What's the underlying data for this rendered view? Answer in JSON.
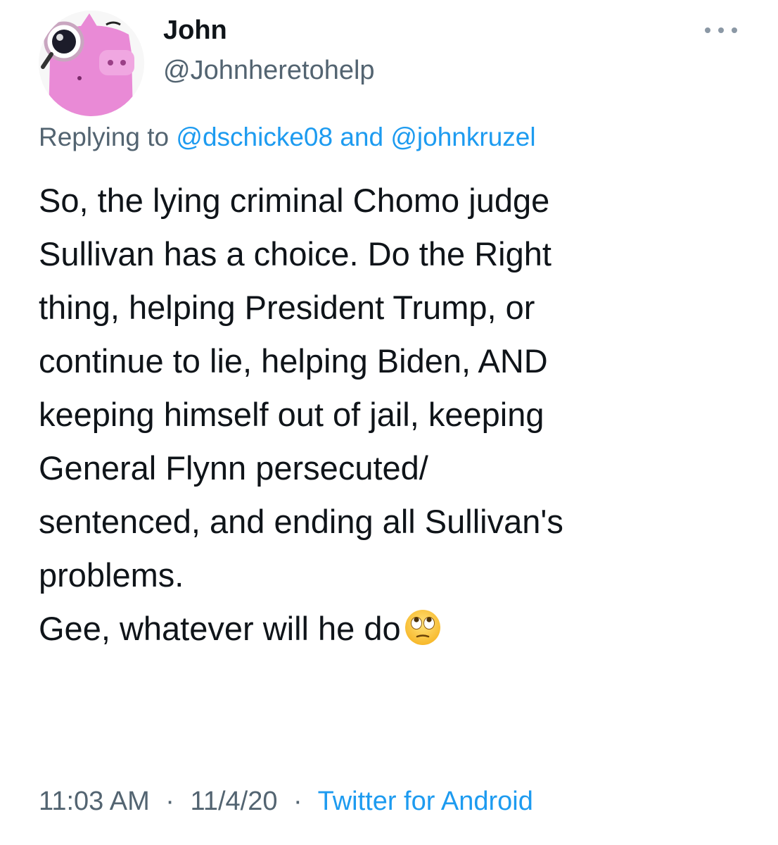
{
  "author": {
    "name": "John",
    "handle": "@Johnheretohelp",
    "avatar_icon": "pink-pig-with-magnifying-glass-avatar"
  },
  "more_icon": "more-horizontal-icon",
  "reply_context": {
    "prefix": "Replying to",
    "mentions": [
      "@dschicke08",
      "@johnkruzel"
    ],
    "joiner": "and"
  },
  "tweet": {
    "lines": [
      "So, the lying criminal Chomo judge",
      "Sullivan has a choice. Do the Right",
      "thing, helping President Trump, or",
      "continue to lie, helping Biden, AND",
      "keeping himself out of jail, keeping",
      "General Flynn persecuted/",
      "sentenced, and ending all Sullivan's",
      "problems.",
      "Gee, whatever will he do"
    ],
    "trailing_emoji": "face-with-rolling-eyes-emoji"
  },
  "meta": {
    "time": "11:03 AM",
    "separator": "·",
    "date": "11/4/20",
    "source": "Twitter for Android"
  },
  "colors": {
    "text": "#0f1419",
    "secondary": "#536471",
    "link": "#1d9bf0",
    "avatar_pink": "#e98ad6"
  }
}
